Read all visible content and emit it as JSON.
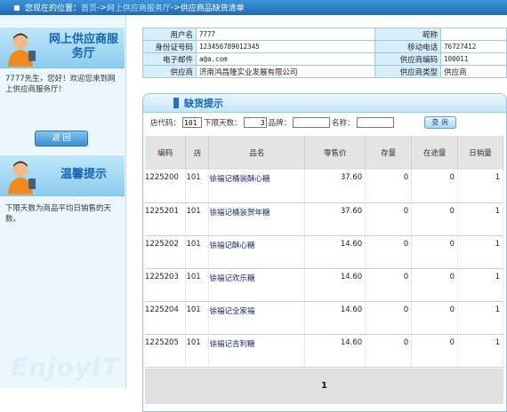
{
  "breadcrumb": {
    "prefix": "您现在的位置：",
    "items": [
      "首页",
      "网上供应商服务厅",
      "供应商品缺货清单"
    ],
    "sep": "->"
  },
  "sidebar": {
    "service_title": "网上供应商服务厅",
    "welcome": "7777先生，您好！欢迎您来到网上供应商服务厅！",
    "back_label": "返 回",
    "tips_title": "温馨提示",
    "tips_text": "下限天数为商品平均日销售的天数。",
    "watermark": "EnjoyIT"
  },
  "info": {
    "user_label": "用户名",
    "user_value": "7777",
    "nick_label": "昵称",
    "nick_value": "",
    "id_label": "身份证号码",
    "id_value": "123456789012345",
    "mobile_label": "移动电话",
    "mobile_value": "76727412",
    "email_label": "电子邮件",
    "email_value": "a@a.com",
    "supcode_label": "供应商编码",
    "supcode_value": "100011",
    "sup_label": "供应商",
    "sup_value": "济南鸿昌隆实业发展有限公司",
    "suptype_label": "供应商类型",
    "suptype_value": "供应商"
  },
  "panel": {
    "title": "缺货提示",
    "search": {
      "store_label": "店代码：",
      "store_value": "101",
      "days_label": "下限天数：",
      "days_value": "3",
      "brand_label": "品牌：",
      "brand_value": "",
      "name_label": "名称：",
      "name_value": "",
      "query_label": "查 询"
    },
    "columns": [
      "编码",
      "店",
      "品名",
      "零售价",
      "存量",
      "在途量",
      "日销量"
    ],
    "rows": [
      {
        "code": "1225200",
        "store": "101",
        "name": "徐福记桶装酥心糖",
        "price": "37.60",
        "stock": "0",
        "transit": "0",
        "daily": "1"
      },
      {
        "code": "1225201",
        "store": "101",
        "name": "徐福记桶装贺年糖",
        "price": "37.60",
        "stock": "0",
        "transit": "0",
        "daily": "1"
      },
      {
        "code": "1225202",
        "store": "101",
        "name": "徐福记酥心糖",
        "price": "14.60",
        "stock": "0",
        "transit": "0",
        "daily": "1"
      },
      {
        "code": "1225203",
        "store": "101",
        "name": "徐福记欢乐糖",
        "price": "14.60",
        "stock": "0",
        "transit": "0",
        "daily": "1"
      },
      {
        "code": "1225204",
        "store": "101",
        "name": "徐福记全家福",
        "price": "14.60",
        "stock": "0",
        "transit": "0",
        "daily": "1"
      },
      {
        "code": "1225205",
        "store": "101",
        "name": "徐福记吉利糖",
        "price": "14.60",
        "stock": "0",
        "transit": "0",
        "daily": "1"
      }
    ],
    "page": "1"
  },
  "colors": {
    "accent": "#1d73c2",
    "sidebar_bg": "#ecf7fd",
    "header_bg": "#d7eefb"
  }
}
